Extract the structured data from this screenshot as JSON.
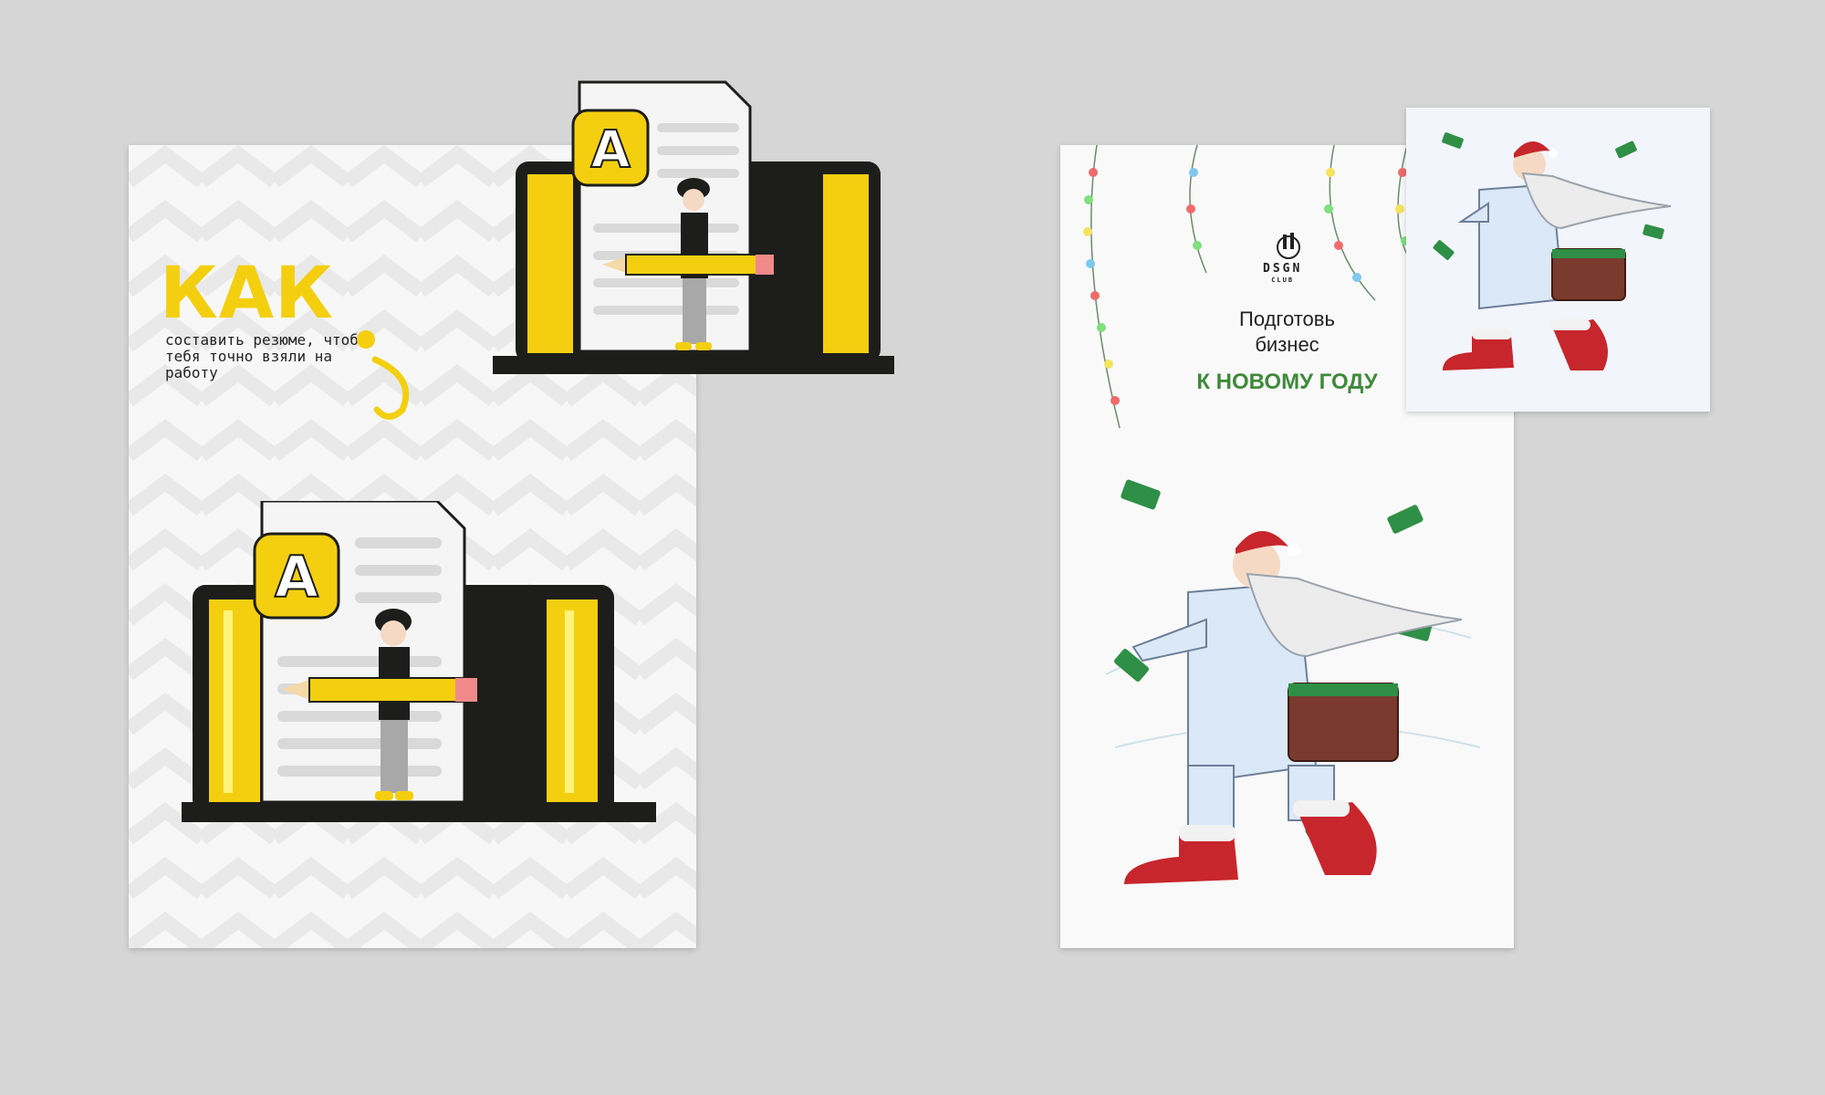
{
  "left_poster": {
    "heading": "КАК",
    "subtitle": "составить резюме, чтобы тебя точно взяли на работу",
    "badge_letter": "A",
    "colors": {
      "accent": "#f4cf10",
      "dark": "#1d1d1b"
    }
  },
  "left_thumbnail": {
    "badge_letter": "A"
  },
  "right_poster": {
    "logo_text": "DSGN",
    "logo_sub": "CLUB",
    "line1": "Подготовь",
    "line2": "бизнес",
    "line3": "К НОВОМУ ГОДУ",
    "colors": {
      "accent": "#3f8a3a",
      "santa_red": "#c7262c",
      "money_green": "#2f8f46"
    }
  }
}
